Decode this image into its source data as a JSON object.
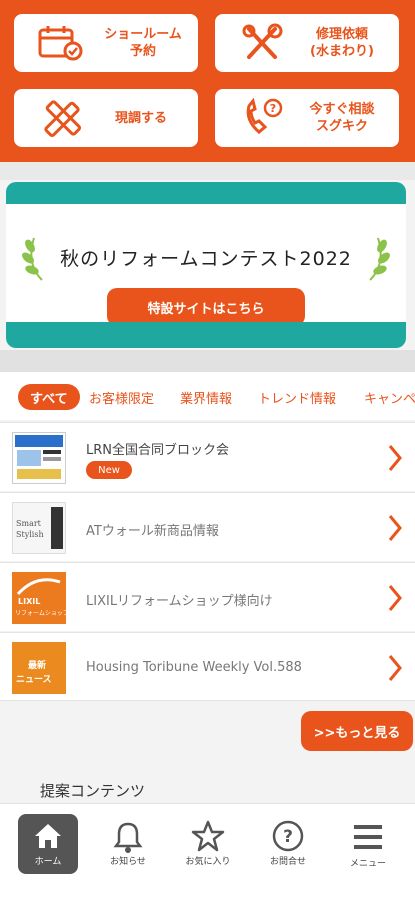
{
  "top_buttons": [
    {
      "label_line1": "ショールーム",
      "label_line2": "予約",
      "icon": "calendar-check-icon"
    },
    {
      "label_line1": "修理依頼",
      "label_line2": "(水まわり)",
      "icon": "tools-icon"
    },
    {
      "label_line1": "現調する",
      "label_line2": "",
      "icon": "pencil-ruler-icon"
    },
    {
      "label_line1": "今すぐ相談",
      "label_line2": "スグキク",
      "icon": "phone-question-icon"
    }
  ],
  "banner": {
    "title": "秋のリフォームコンテスト2022",
    "cta": "特設サイトはこちら"
  },
  "tabs": [
    "すべて",
    "お客様限定",
    "業界情報",
    "トレンド情報",
    "キャンペ"
  ],
  "news": [
    {
      "title": "LRN全国合同ブロック会",
      "badge": "New",
      "thumb": "flyer"
    },
    {
      "title": "ATウォール新商品情報",
      "badge": "",
      "thumb": "smart-stylish",
      "thumb_text_1": "Smart",
      "thumb_text_2": "Stylish"
    },
    {
      "title": "LIXILリフォームショップ様向け",
      "badge": "",
      "thumb": "lixil",
      "thumb_text_1": "LIXIL",
      "thumb_text_2": "リフォームショップ"
    },
    {
      "title": "Housing Toribune Weekly Vol.588",
      "badge": "",
      "thumb": "news",
      "thumb_text_1": "最新",
      "thumb_text_2": "ニュース"
    }
  ],
  "more_button": ">>もっと見る",
  "section_title": "提案コンテンツ",
  "nav": [
    {
      "label": "ホーム",
      "icon": "home-icon",
      "active": true
    },
    {
      "label": "お知らせ",
      "icon": "bell-icon",
      "active": false
    },
    {
      "label": "お気に入り",
      "icon": "star-icon",
      "active": false
    },
    {
      "label": "お問合せ",
      "icon": "question-icon",
      "active": false
    },
    {
      "label": "メニュー",
      "icon": "menu-icon",
      "active": false
    }
  ],
  "colors": {
    "accent": "#e8541c",
    "teal": "#1fa8a0"
  }
}
